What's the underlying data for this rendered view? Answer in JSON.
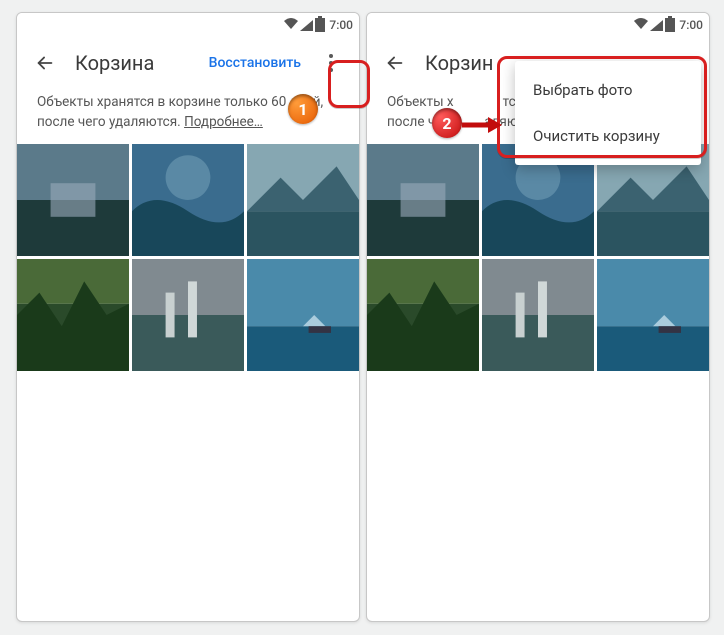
{
  "status": {
    "time": "7:00"
  },
  "appbar": {
    "title": "Корзина",
    "restore": "Восстановить"
  },
  "info": {
    "text": "Объекты хранятся в корзине только 60 дней, после чего удаляются. ",
    "link": "Подробнее…",
    "text_partial_left": "Объекты х",
    "text_partial_right": "тся в корзине",
    "text2_partial": "после ч",
    "text2_partial_right": "аляются."
  },
  "menu": {
    "select": "Выбрать фото",
    "clear": "Очистить корзину"
  },
  "annotations": {
    "b1": "1",
    "b2": "2"
  },
  "right_title_partial": "Корзин"
}
